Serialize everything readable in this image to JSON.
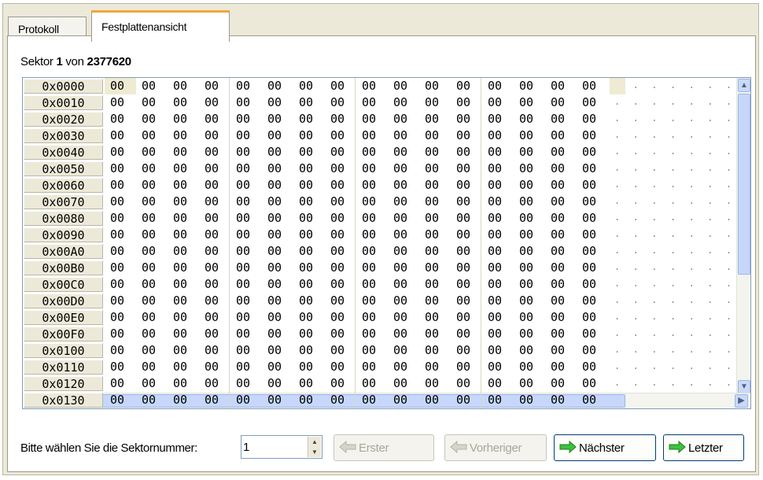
{
  "tabs": [
    {
      "label": "Protokoll"
    },
    {
      "label": "Festplattenansicht"
    }
  ],
  "sector": {
    "prefix": "Sektor",
    "current": "1",
    "separator": "von",
    "total": "2377620"
  },
  "hex_view": {
    "addresses": [
      "0x0000",
      "0x0010",
      "0x0020",
      "0x0030",
      "0x0040",
      "0x0050",
      "0x0060",
      "0x0070",
      "0x0080",
      "0x0090",
      "0x00A0",
      "0x00B0",
      "0x00C0",
      "0x00D0",
      "0x00E0",
      "0x00F0",
      "0x0100",
      "0x0110",
      "0x0120",
      "0x0130"
    ],
    "byte_value": "00",
    "bytes_per_row": 16,
    "ascii_row": ". . . . . . . . . . . . . . . ."
  },
  "footer": {
    "prompt_label": "Bitte wählen Sie die Sektornummer:",
    "sector_input_value": "1",
    "buttons": {
      "first": "Erster",
      "previous": "Vorheriger",
      "next": "Nächster",
      "last": "Letzter"
    }
  },
  "colors": {
    "accent_tab": "#f2a63a",
    "arrow_enabled": "#3cc23c",
    "arrow_disabled": "#c9c8bd",
    "scroll": "#c6d7fb"
  }
}
